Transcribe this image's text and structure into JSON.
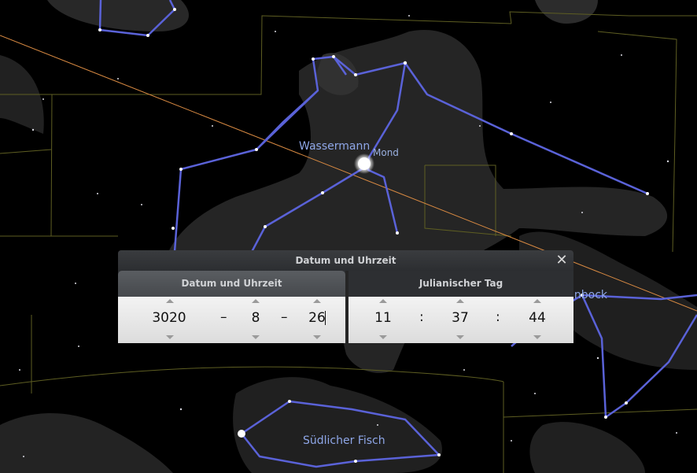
{
  "sky": {
    "constellations": [
      {
        "name": "Wassermann"
      },
      {
        "name": "Steinbock"
      },
      {
        "name": "Südlicher Fisch"
      }
    ],
    "moon_label": "Mond",
    "colors": {
      "constellation_line": "#5a62d8",
      "ecliptic": "#e08a3a",
      "boundary": "#6b6b2a",
      "label": "#8fa7e8"
    }
  },
  "dialog": {
    "title": "Datum und Uhrzeit",
    "close_icon": "close-icon",
    "tab_date": "Datum und Uhrzeit",
    "tab_julian": "Julianischer Tag",
    "date": {
      "year": "3020",
      "month": "8",
      "day": "26",
      "separator": "–"
    },
    "time": {
      "hour": "11",
      "minute": "37",
      "second": "44",
      "separator": ":"
    }
  }
}
